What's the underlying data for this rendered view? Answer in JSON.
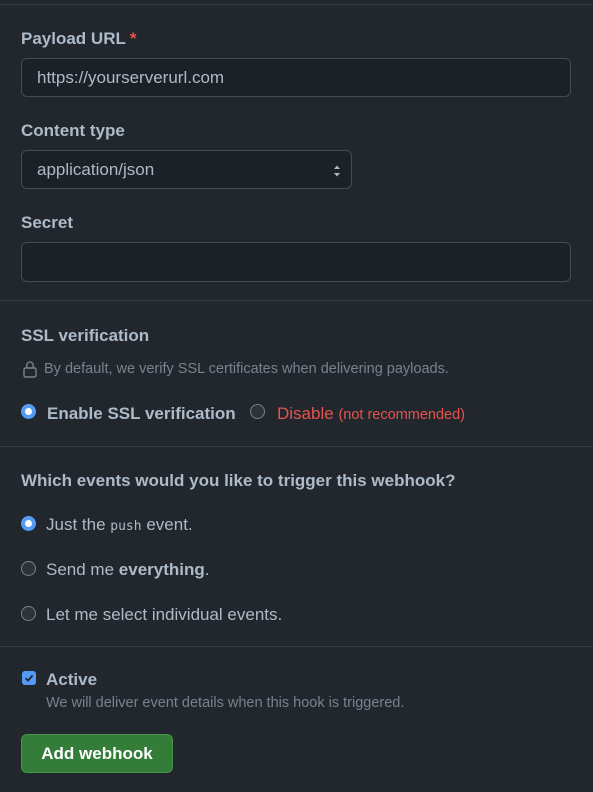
{
  "payload": {
    "label": "Payload URL",
    "required_mark": "*",
    "value": "https://yourserverurl.com"
  },
  "content_type": {
    "label": "Content type",
    "selected": "application/json"
  },
  "secret": {
    "label": "Secret",
    "value": ""
  },
  "ssl": {
    "title": "SSL verification",
    "note": "By default, we verify SSL certificates when delivering payloads.",
    "enable_label": "Enable SSL verification",
    "disable_label": "Disable",
    "disable_note": "(not recommended)",
    "selected": "enable"
  },
  "events": {
    "title": "Which events would you like to trigger this webhook?",
    "option1_prefix": "Just the",
    "option1_code": "push",
    "option1_suffix": "event.",
    "option2_prefix": "Send me",
    "option2_bold": "everything",
    "option2_suffix": ".",
    "option3": "Let me select individual events.",
    "selected": "push"
  },
  "active": {
    "label": "Active",
    "description": "We will deliver event details when this hook is triggered.",
    "checked": true
  },
  "submit_label": "Add webhook",
  "colors": {
    "background": "#22272e",
    "accent": "#539bf5",
    "danger": "#e5534b",
    "primary_button": "#347d39"
  },
  "icons": {
    "lock": "lock-icon",
    "select": "select-chevron-icon",
    "check": "checkmark-icon"
  }
}
